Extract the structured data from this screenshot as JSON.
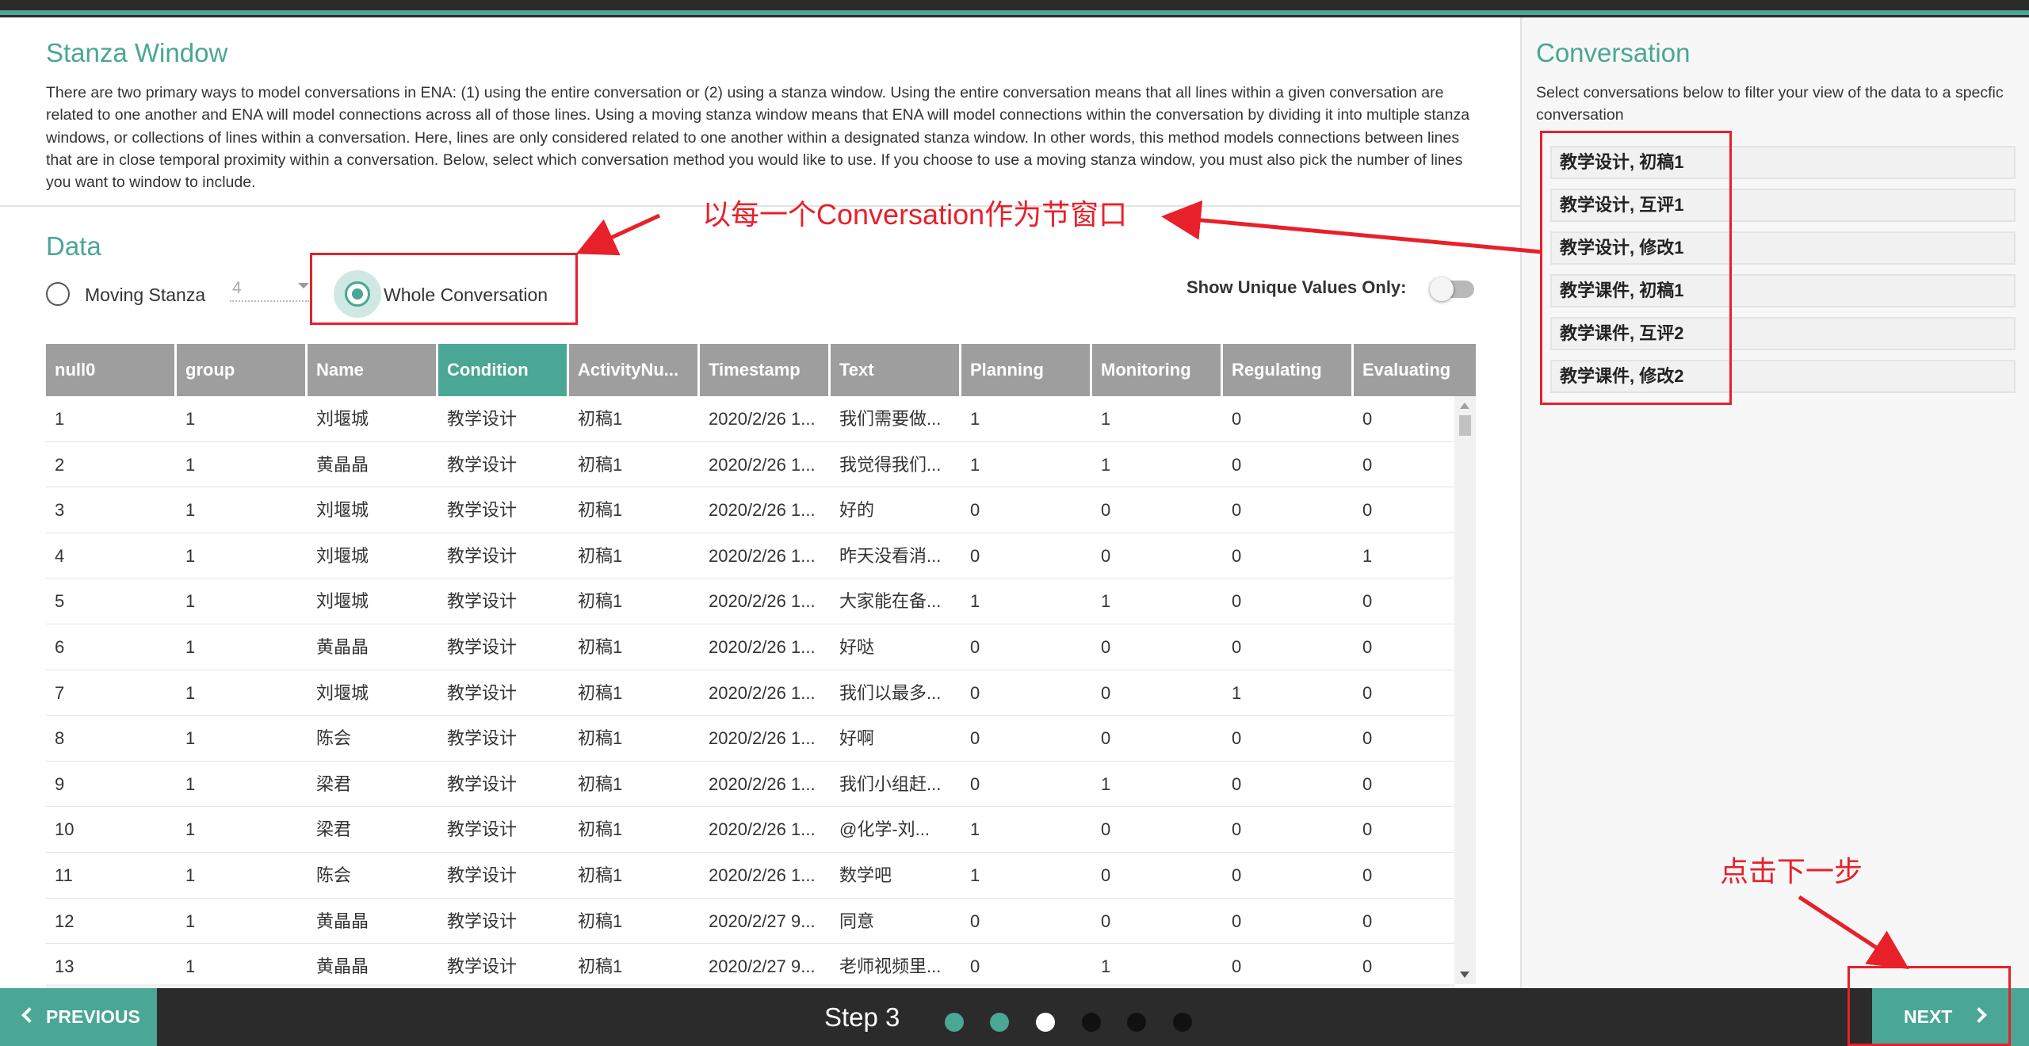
{
  "stanza": {
    "title": "Stanza Window",
    "description": "There are two primary ways to model conversations in ENA: (1) using the entire conversation or (2) using a stanza window. Using the entire conversation means that all lines within a given conversation are related to one another and ENA will model connections across all of those lines. Using a moving stanza window means that ENA will model connections within the conversation by dividing it into multiple stanza windows, or collections of lines within a conversation. Here, lines are only considered related to one another within a designated stanza window. In other words, this method models connections between lines that are in close temporal proximity within a conversation. Below, select which conversation method you would like to use. If you choose to use a moving stanza window, you must also pick the number of lines you want to window to include."
  },
  "data_section": {
    "title": "Data",
    "moving_stanza_label": "Moving Stanza",
    "window_size": "4",
    "whole_conversation_label": "Whole Conversation",
    "selected_method": "Whole Conversation",
    "unique_toggle_label": "Show Unique Values Only:",
    "unique_toggle_on": false
  },
  "table": {
    "columns": [
      "null0",
      "group",
      "Name",
      "Condition",
      "ActivityNu...",
      "Timestamp",
      "Text",
      "Planning",
      "Monitoring",
      "Regulating",
      "Evaluating"
    ],
    "active_column": "Condition",
    "rows": [
      [
        "1",
        "1",
        "刘堰城",
        "教学设计",
        "初稿1",
        "2020/2/26 1...",
        "我们需要做...",
        "1",
        "1",
        "0",
        "0"
      ],
      [
        "2",
        "1",
        "黄晶晶",
        "教学设计",
        "初稿1",
        "2020/2/26 1...",
        "我觉得我们...",
        "1",
        "1",
        "0",
        "0"
      ],
      [
        "3",
        "1",
        "刘堰城",
        "教学设计",
        "初稿1",
        "2020/2/26 1...",
        "好的",
        "0",
        "0",
        "0",
        "0"
      ],
      [
        "4",
        "1",
        "刘堰城",
        "教学设计",
        "初稿1",
        "2020/2/26 1...",
        "昨天没看消...",
        "0",
        "0",
        "0",
        "1"
      ],
      [
        "5",
        "1",
        "刘堰城",
        "教学设计",
        "初稿1",
        "2020/2/26 1...",
        "大家能在备...",
        "1",
        "1",
        "0",
        "0"
      ],
      [
        "6",
        "1",
        "黄晶晶",
        "教学设计",
        "初稿1",
        "2020/2/26 1...",
        "好哒",
        "0",
        "0",
        "0",
        "0"
      ],
      [
        "7",
        "1",
        "刘堰城",
        "教学设计",
        "初稿1",
        "2020/2/26 1...",
        "我们以最多...",
        "0",
        "0",
        "1",
        "0"
      ],
      [
        "8",
        "1",
        "陈会",
        "教学设计",
        "初稿1",
        "2020/2/26 1...",
        "好啊",
        "0",
        "0",
        "0",
        "0"
      ],
      [
        "9",
        "1",
        "梁君",
        "教学设计",
        "初稿1",
        "2020/2/26 1...",
        "我们小组赶...",
        "0",
        "1",
        "0",
        "0"
      ],
      [
        "10",
        "1",
        "梁君",
        "教学设计",
        "初稿1",
        "2020/2/26 1...",
        "@化学-刘...",
        "1",
        "0",
        "0",
        "0"
      ],
      [
        "11",
        "1",
        "陈会",
        "教学设计",
        "初稿1",
        "2020/2/26 1...",
        "数学吧",
        "1",
        "0",
        "0",
        "0"
      ],
      [
        "12",
        "1",
        "黄晶晶",
        "教学设计",
        "初稿1",
        "2020/2/27 9...",
        "同意",
        "0",
        "0",
        "0",
        "0"
      ],
      [
        "13",
        "1",
        "黄晶晶",
        "教学设计",
        "初稿1",
        "2020/2/27 9...",
        "老师视频里...",
        "0",
        "1",
        "0",
        "0"
      ]
    ]
  },
  "conversation": {
    "title": "Conversation",
    "description": "Select conversations below to filter your view of the data to a specfic conversation",
    "items": [
      "教学设计, 初稿1",
      "教学设计, 互评1",
      "教学设计, 修改1",
      "教学课件, 初稿1",
      "教学课件, 互评2",
      "教学课件, 修改2"
    ]
  },
  "footer": {
    "previous_label": "PREVIOUS",
    "next_label": "NEXT",
    "step_label": "Step 3",
    "step_total": 6,
    "step_current": 3
  },
  "annotations": {
    "window_note": "以每一个Conversation作为节窗口",
    "next_note": "点击下一步"
  },
  "colors": {
    "accent": "#4aa695",
    "annotation_red": "#e8202a",
    "header_gray": "#9e9e9e",
    "dark_bar": "#2b2b2b"
  }
}
